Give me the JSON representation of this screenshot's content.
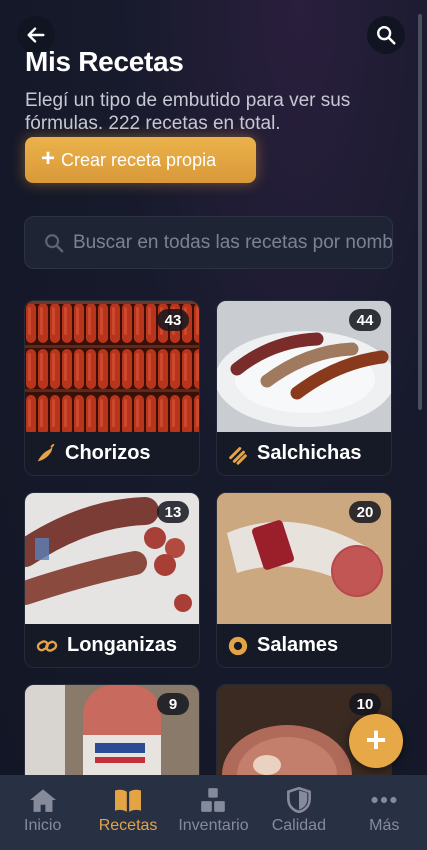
{
  "header": {
    "title": "Mis Recetas",
    "subtitle": "Elegí un tipo de embutido para ver sus fórmulas. 222 recetas en total.",
    "back_icon": "arrow-left-icon",
    "search_icon": "search-icon"
  },
  "create_button": {
    "plus": "+",
    "label": "Crear receta propia"
  },
  "search": {
    "placeholder": "Buscar en todas las recetas por nombre"
  },
  "categories": [
    {
      "name": "Chorizos",
      "count": "43",
      "icon": "chili-pepper-icon"
    },
    {
      "name": "Salchichas",
      "count": "44",
      "icon": "sausage-links-icon"
    },
    {
      "name": "Longanizas",
      "count": "13",
      "icon": "chain-link-icon"
    },
    {
      "name": "Salames",
      "count": "20",
      "icon": "salami-slice-icon"
    },
    {
      "name": "",
      "count": "9",
      "icon": ""
    },
    {
      "name": "",
      "count": "10",
      "icon": ""
    }
  ],
  "fab": {
    "label": "+"
  },
  "nav": [
    {
      "label": "Inicio",
      "icon": "home-icon",
      "active": false
    },
    {
      "label": "Recetas",
      "icon": "book-icon",
      "active": true
    },
    {
      "label": "Inventario",
      "icon": "boxes-icon",
      "active": false
    },
    {
      "label": "Calidad",
      "icon": "shield-icon",
      "active": false
    },
    {
      "label": "Más",
      "icon": "more-dots-icon",
      "active": false
    }
  ],
  "colors": {
    "accent": "#e4a445",
    "background": "#161a2b",
    "card": "#161a26",
    "nav": "#283043"
  }
}
